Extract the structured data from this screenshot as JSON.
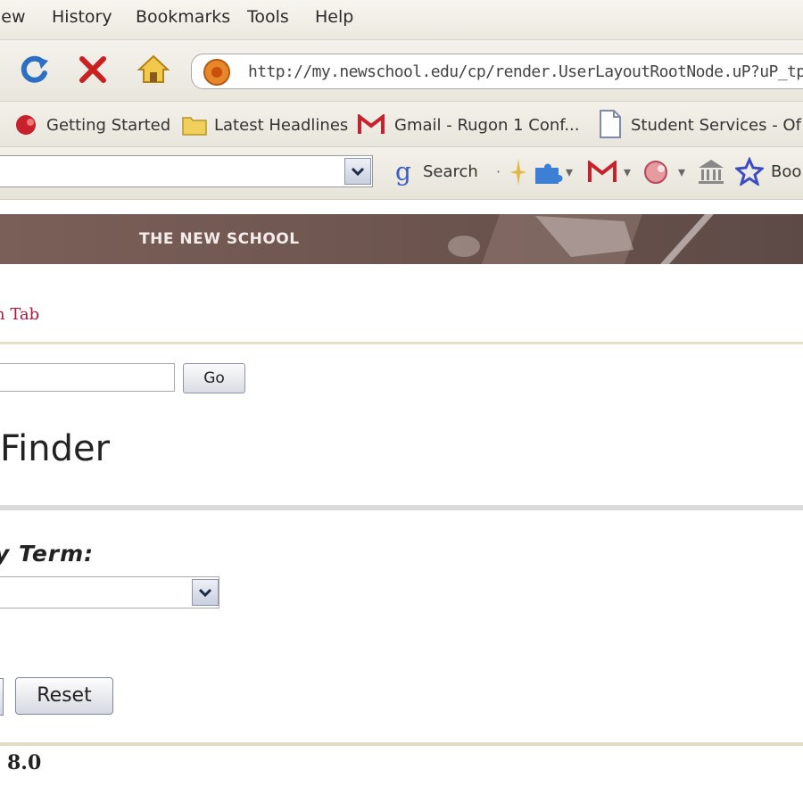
{
  "menu": {
    "items": [
      "iew",
      "History",
      "Bookmarks",
      "Tools",
      "Help"
    ]
  },
  "address_bar": {
    "url": "http://my.newschool.edu/cp/render.UserLayoutRootNode.uP?uP_tp"
  },
  "bookmarks": {
    "items": [
      "Getting Started",
      "Latest Headlines",
      "Gmail - Rugon 1 Conf...",
      "Student Services - Of"
    ]
  },
  "toolbar": {
    "search_label": "Search",
    "bookmarks_label": "Boo"
  },
  "page": {
    "banner_text": "THE NEW SCHOOL",
    "tab_link": "n Tab",
    "go_button": "Go",
    "title": "Finder",
    "term_label": "y Term:",
    "reset_button": "Reset",
    "version": "8.0"
  },
  "colors": {
    "link_red": "#b3163a",
    "banner": "#6f5650",
    "stop_red": "#cc1f1f",
    "reload_blue": "#2d6fc2"
  }
}
